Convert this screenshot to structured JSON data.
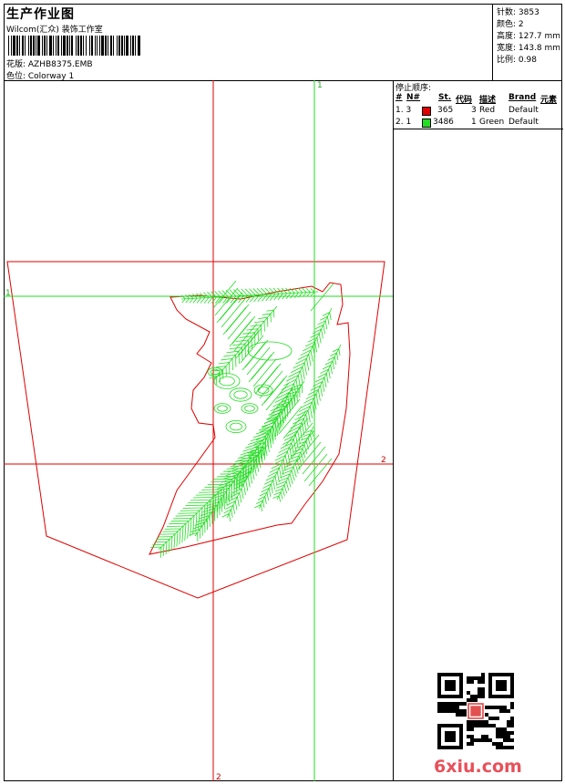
{
  "header": {
    "title": "生产作业图",
    "company": "Wilcom(汇众) 装饰工作室",
    "design": "花版: AZHB8375.EMB",
    "colorway": "色位: Colorway 1"
  },
  "stats": {
    "stitches": "针数: 3853",
    "colors": "颜色: 2",
    "height": "高度: 127.7 mm",
    "width": "宽度: 143.8 mm",
    "scale": "比例: 0.98"
  },
  "stop_sequence": {
    "title": "停止顺序:",
    "columns": {
      "num": "#",
      "needle": "N#",
      "stitches": "St.",
      "code": "代码",
      "desc": "描述",
      "brand": "Brand",
      "element": "元素"
    },
    "rows": [
      {
        "num": "1. 3",
        "color": "#e00000",
        "stitches": "365",
        "code": "3",
        "desc": "Red",
        "brand": "Default"
      },
      {
        "num": "2. 1",
        "color": "#22dd22",
        "stitches": "3486",
        "code": "1",
        "desc": "Green",
        "brand": "Default"
      }
    ]
  },
  "guides": {
    "v1": "1",
    "h1": "1",
    "h2": "2",
    "v2": "2"
  },
  "watermark": "6xiu.com",
  "colors": {
    "outline": "#e00000",
    "stitch": "#22dd22"
  }
}
